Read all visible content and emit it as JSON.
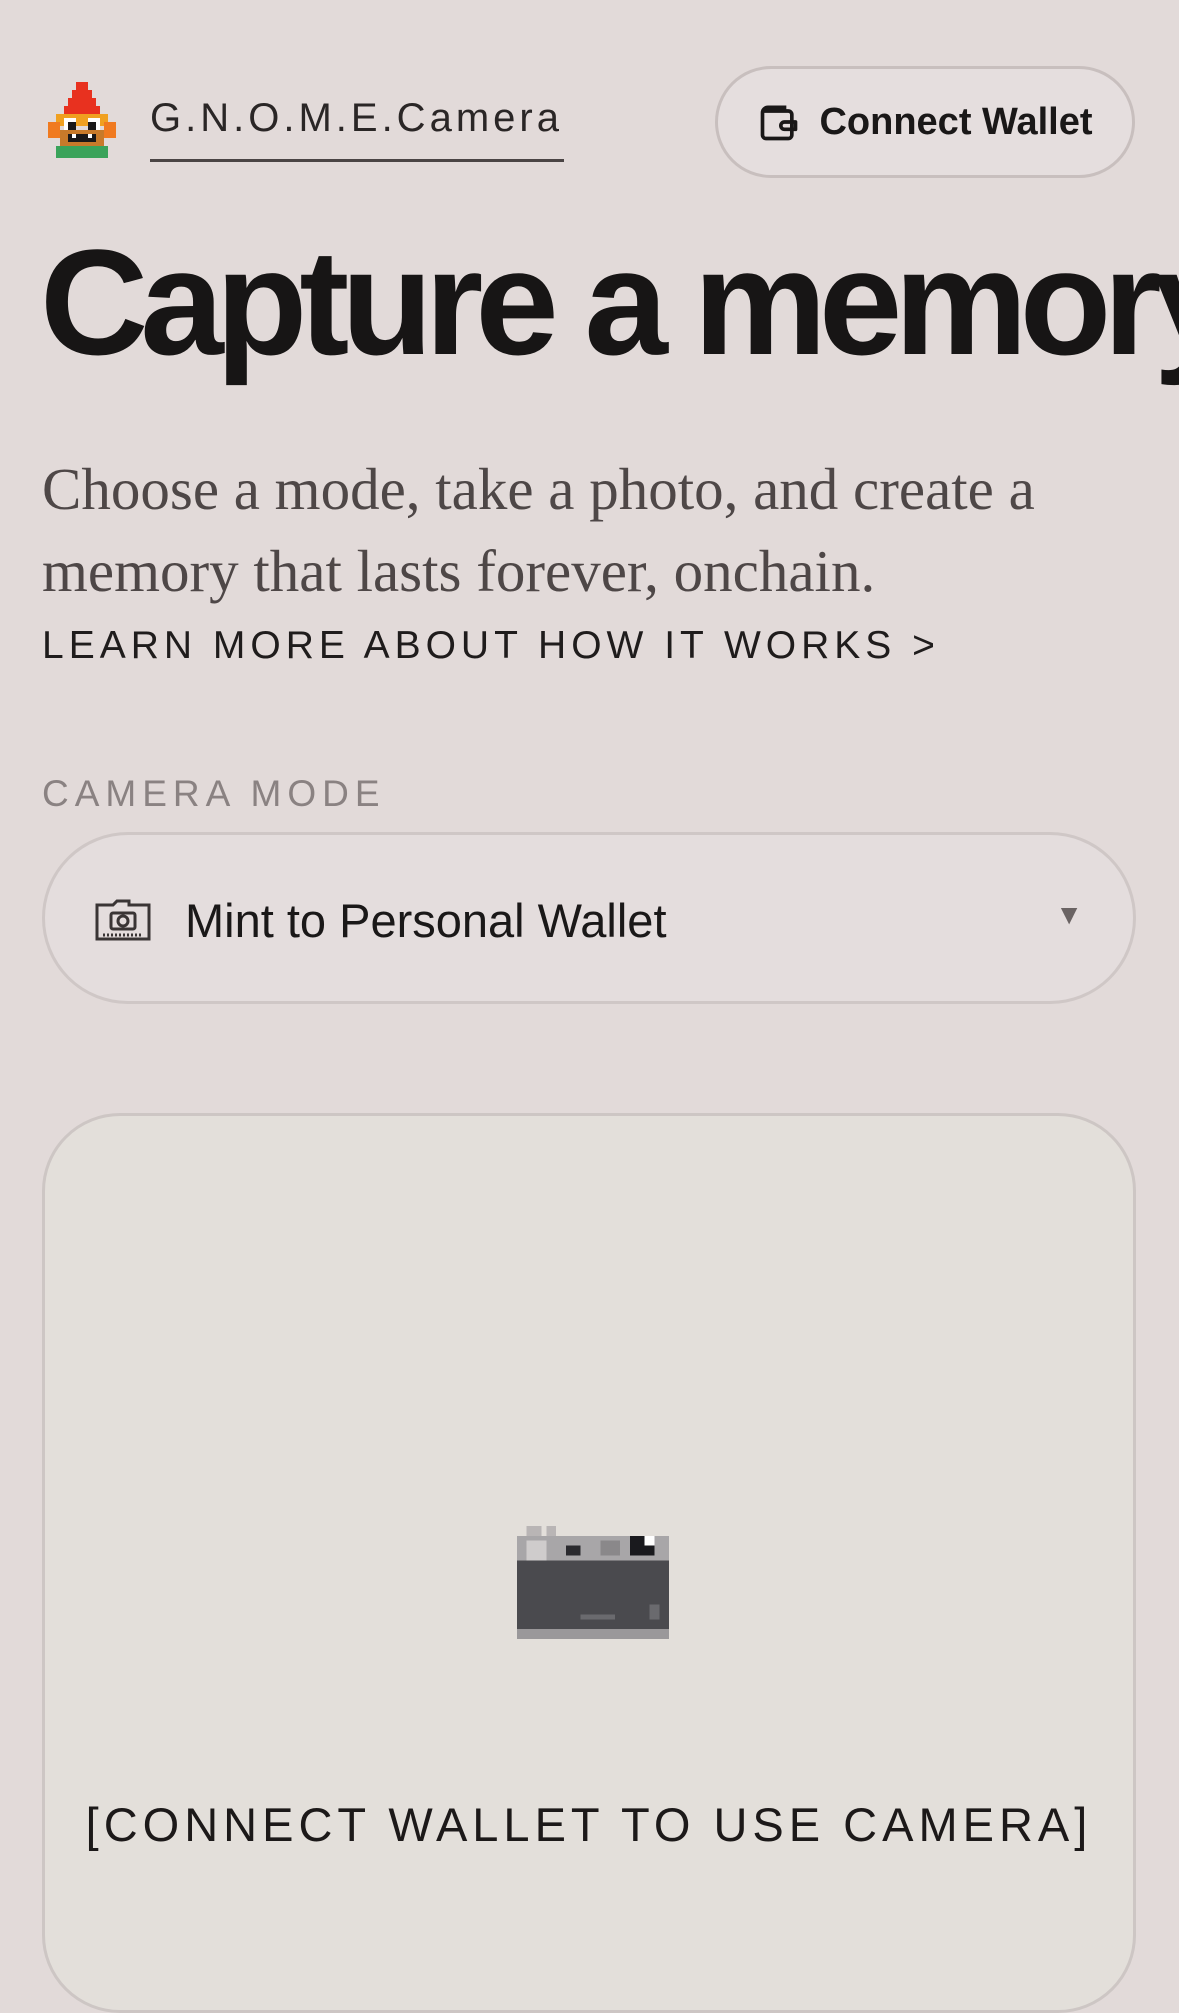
{
  "header": {
    "brand": "G.N.O.M.E.Camera",
    "connect_wallet_label": "Connect Wallet"
  },
  "hero": {
    "title": "Capture a memory",
    "subtitle": "Choose a mode, take a photo, and create a memory that lasts forever, onchain.",
    "learn_more": "LEARN MORE ABOUT HOW IT WORKS >"
  },
  "mode": {
    "label": "CAMERA MODE",
    "selected": "Mint to Personal Wallet",
    "caret": "▼"
  },
  "camera": {
    "cta": "[CONNECT WALLET TO USE CAMERA]"
  },
  "icons": {
    "logo": "gnome-logo-icon",
    "wallet": "wallet-icon",
    "mode": "folder-camera-icon",
    "camera": "pixel-camera-icon"
  },
  "colors": {
    "background": "#e2dad9",
    "text": "#1a1818",
    "muted": "#8a8282",
    "border": "#cdc6c4",
    "panel": "#e3dfda"
  }
}
